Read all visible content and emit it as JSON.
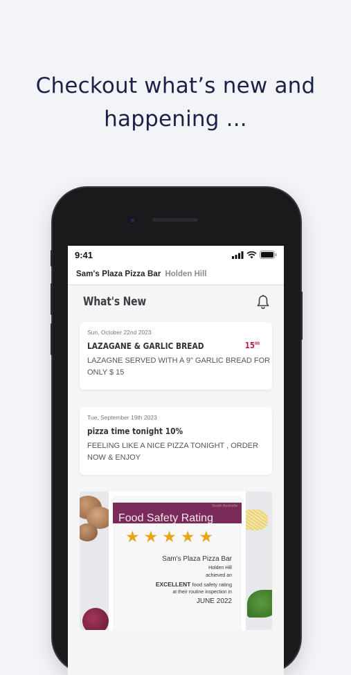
{
  "headline": {
    "line1": "Checkout what’s new and",
    "line2": "happening ..."
  },
  "status_bar": {
    "time": "9:41",
    "icons": [
      "signal-icon",
      "wifi-icon",
      "battery-icon"
    ]
  },
  "app_header": {
    "restaurant_name": "Sam's Plaza Pizza Bar",
    "location": "Holden Hill"
  },
  "section": {
    "title": "What's New",
    "icon": "bell-icon"
  },
  "news": [
    {
      "date": "Sun, October 22nd 2023",
      "title": "LAZAGANE & GARLIC BREAD",
      "price": "15",
      "price_cents": "00",
      "body": "LAZAGNE SERVED WITH A 9\" GARLIC BREAD FOR ONLY $ 15"
    },
    {
      "date": "Tue, September 19th 2023",
      "title": "pizza time tonight 10%",
      "body": "FEELING LIKE A NICE PIZZA TONIGHT , ORDER NOW & ENJOY"
    }
  ],
  "promo_certificate": {
    "region": "South Australia",
    "heading": "Food Safety Rating",
    "stars": 5,
    "business": "Sam's Plaza Pizza Bar",
    "suburb": "Holden Hill",
    "achieved": "achieved an",
    "excellent_word": "EXCELLENT",
    "excellent_rest": "food safety rating",
    "inspection": "at their routine inspection in",
    "date": "JUNE 2022"
  },
  "colors": {
    "background": "#f2f4f8",
    "headline": "#1d2147",
    "price_accent": "#c2185b",
    "certificate_banner": "#7b2b5a",
    "star": "#e8a51c"
  }
}
